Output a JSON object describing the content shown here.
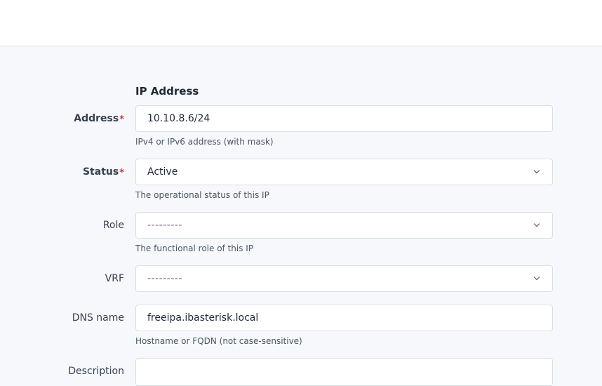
{
  "section": {
    "title": "IP Address"
  },
  "fields": {
    "address": {
      "label": "Address",
      "required_mark": "*",
      "value": "10.10.8.6/24",
      "help": "IPv4 or IPv6 address (with mask)"
    },
    "status": {
      "label": "Status",
      "required_mark": "*",
      "value": "Active",
      "help": "The operational status of this IP",
      "icon": "chevron-down-icon"
    },
    "role": {
      "label": "Role",
      "value": "---------",
      "help": "The functional role of this IP",
      "icon": "chevron-down-icon"
    },
    "vrf": {
      "label": "VRF",
      "value": "---------",
      "icon": "chevron-down-icon"
    },
    "dns_name": {
      "label": "DNS name",
      "value": "freeipa.ibasterisk.local",
      "help": "Hostname or FQDN (not case-sensitive)"
    },
    "description": {
      "label": "Description",
      "value": ""
    }
  },
  "colors": {
    "background": "#f6f8fb",
    "required": "#d63939",
    "border": "#dadfe5"
  }
}
